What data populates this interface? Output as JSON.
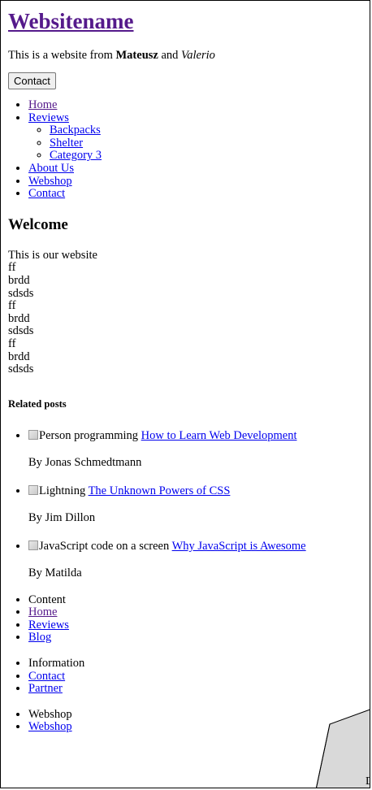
{
  "header": {
    "site_title": "Websitename",
    "tagline_prefix": "This is a website from ",
    "tagline_bold": "Mateusz",
    "tagline_middle": " and ",
    "tagline_italic": "Valerio",
    "contact_button": "Contact"
  },
  "nav": {
    "home": "Home",
    "reviews": "Reviews",
    "reviews_sub": [
      "Backpacks",
      "Shelter",
      "Category 3"
    ],
    "about": "About Us",
    "webshop": "Webshop",
    "contact": "Contact"
  },
  "main": {
    "heading": "Welcome",
    "intro": "This is our website",
    "lines": [
      "ff",
      "brdd",
      "sdsds",
      "ff",
      "brdd",
      "sdsds",
      "ff",
      "brdd",
      "sdsds"
    ]
  },
  "related": {
    "title": "Related posts",
    "posts": [
      {
        "img_alt": "Person programming",
        "link": "How to Learn Web Development",
        "byline": "By Jonas Schmedtmann"
      },
      {
        "img_alt": "Lightning",
        "link": "The Unknown Powers of CSS",
        "byline": "By Jim Dillon"
      },
      {
        "img_alt": "JavaScript code on a screen",
        "link": "Why JavaScript is Awesome",
        "byline": "By Matilda"
      }
    ]
  },
  "footer": {
    "content_label": "Content",
    "content_links": [
      "Home",
      "Reviews",
      "Blog"
    ],
    "information_label": "Information",
    "information_links": [
      "Contact",
      "Partner"
    ],
    "webshop_label": "Webshop",
    "webshop_links": [
      "Webshop"
    ]
  },
  "decor": {
    "letter": "D"
  },
  "colors": {
    "link": "#0000ee",
    "visited": "#551a8b"
  }
}
